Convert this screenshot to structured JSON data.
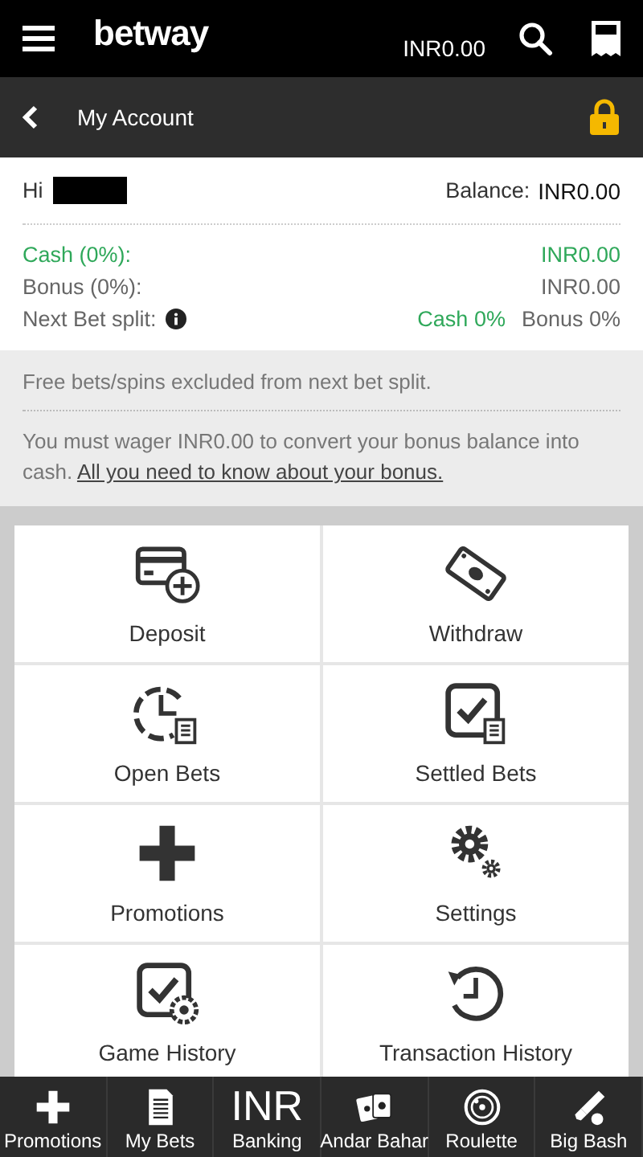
{
  "header": {
    "logo": "betway",
    "balance": "INR0.00"
  },
  "subheader": {
    "title": "My Account"
  },
  "account": {
    "greeting": "Hi",
    "balance_label": "Balance:",
    "balance": "INR0.00",
    "rows": [
      {
        "label": "Cash (0%):",
        "value": "INR0.00",
        "kind": "cash"
      },
      {
        "label": "Bonus (0%):",
        "value": "INR0.00",
        "kind": "bonus"
      }
    ],
    "split": {
      "label": "Next Bet split:",
      "cash": "Cash 0%",
      "bonus": "Bonus 0%"
    }
  },
  "info": {
    "note": "Free bets/spins excluded from next bet split.",
    "wager": "You must wager INR0.00 to convert your bonus balance into cash.",
    "link": "All you need to know about your bonus."
  },
  "tiles": [
    {
      "label": "Deposit",
      "kind": "deposit"
    },
    {
      "label": "Withdraw",
      "kind": "withdraw"
    },
    {
      "label": "Open Bets",
      "kind": "open"
    },
    {
      "label": "Settled Bets",
      "kind": "settled"
    },
    {
      "label": "Promotions",
      "kind": "promo"
    },
    {
      "label": "Settings",
      "kind": "settings"
    },
    {
      "label": "Game History",
      "kind": "game"
    },
    {
      "label": "Transaction History",
      "kind": "transaction"
    }
  ],
  "bottom_nav": [
    {
      "label": "Promotions",
      "kind": "plus"
    },
    {
      "label": "My Bets",
      "kind": "doc"
    },
    {
      "label": "Banking",
      "kind": "text",
      "icon_text": "INR"
    },
    {
      "label": "Andar Bahar",
      "kind": "cards"
    },
    {
      "label": "Roulette",
      "kind": "roulette"
    },
    {
      "label": "Big Bash",
      "kind": "cricket"
    }
  ]
}
